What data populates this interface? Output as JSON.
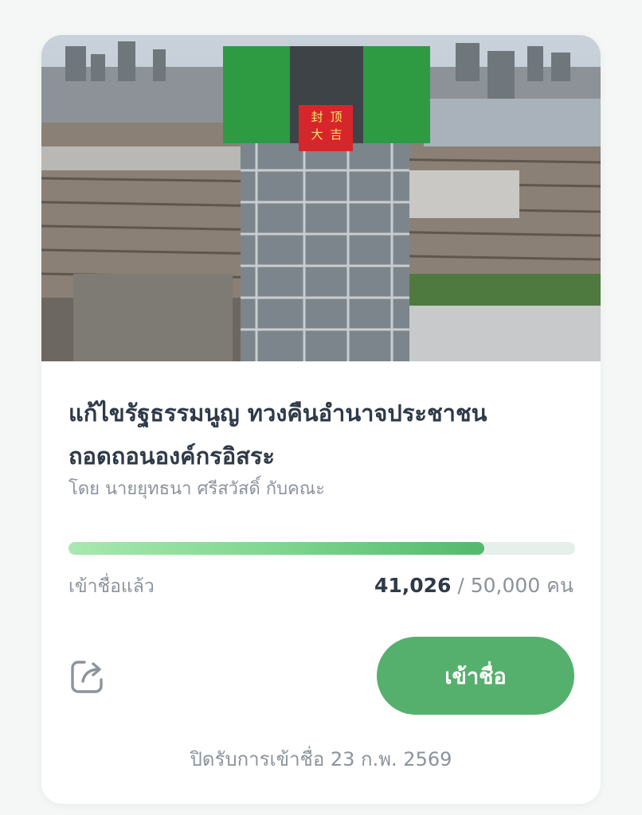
{
  "petition": {
    "image_alt": "building-under-construction-photo",
    "banner_text": [
      "封",
      "顶",
      "大",
      "吉"
    ],
    "title": "แก้ไขรัฐธรรมนูญ ทวงคืนอำนาจประชาชน ถอดถอนองค์กรอิสระ",
    "author": "โดย นายยุทธนา ศรีสวัสดิ์ กับคณะ"
  },
  "progress": {
    "fraction": 0.82052,
    "label": "เข้าชื่อแล้ว",
    "current": "41,026",
    "separator": " / ",
    "target_text": "50,000 คน"
  },
  "actions": {
    "share_icon": "share-icon",
    "sign_label": "เข้าชื่อ"
  },
  "footer": {
    "closing_text": "ปิดรับการเข้าชื่อ 23 ก.พ. 2569"
  },
  "colors": {
    "accent": "#56b06d",
    "title": "#2e3a48",
    "muted": "#8b939d",
    "track": "#e6efe9"
  }
}
